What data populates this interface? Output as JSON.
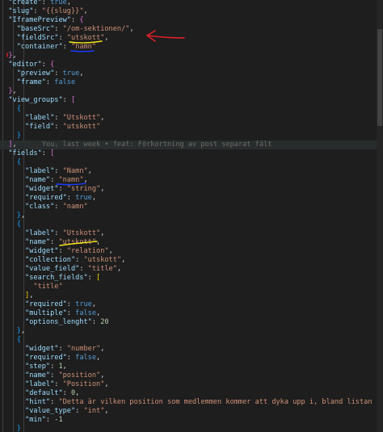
{
  "editor": {
    "blame_annotation": "You, last week • feat: Förkortning av post separat fält",
    "lines": [
      [
        [
          "p",
          "  "
        ],
        [
          "k",
          "\"create\""
        ],
        [
          "p",
          ": "
        ],
        [
          "b",
          "true"
        ],
        [
          "p",
          ","
        ]
      ],
      [
        [
          "p",
          "  "
        ],
        [
          "k",
          "\"slug\""
        ],
        [
          "p",
          ": "
        ],
        [
          "s",
          "\"{{slug}}\""
        ],
        [
          "p",
          ","
        ]
      ],
      [
        [
          "p",
          "  "
        ],
        [
          "k",
          "\"IframePreview\""
        ],
        [
          "p",
          ": "
        ],
        [
          "br2",
          "{"
        ]
      ],
      [
        [
          "p",
          "    "
        ],
        [
          "k",
          "\"baseSrc\""
        ],
        [
          "p",
          ": "
        ],
        [
          "s",
          "\"/om-sektionen/\""
        ],
        [
          "p",
          ","
        ]
      ],
      [
        [
          "p",
          "    "
        ],
        [
          "k",
          "\"fieldSrc\""
        ],
        [
          "p",
          ": "
        ],
        [
          "s",
          "\"utskott\""
        ],
        [
          "p",
          ","
        ]
      ],
      [
        [
          "p",
          "    "
        ],
        [
          "k",
          "\"container\""
        ],
        [
          "p",
          ": "
        ],
        [
          "s",
          "\"namn\""
        ]
      ],
      [
        [
          "p",
          "  "
        ],
        [
          "br2",
          "}"
        ],
        [
          "p",
          ","
        ]
      ],
      [
        [
          "p",
          "  "
        ],
        [
          "k",
          "\"editor\""
        ],
        [
          "p",
          ": "
        ],
        [
          "br2",
          "{"
        ]
      ],
      [
        [
          "p",
          "    "
        ],
        [
          "k",
          "\"preview\""
        ],
        [
          "p",
          ": "
        ],
        [
          "b",
          "true"
        ],
        [
          "p",
          ","
        ]
      ],
      [
        [
          "p",
          "    "
        ],
        [
          "k",
          "\"frame\""
        ],
        [
          "p",
          ": "
        ],
        [
          "b",
          "false"
        ]
      ],
      [
        [
          "p",
          "  "
        ],
        [
          "br2",
          "}"
        ],
        [
          "p",
          ","
        ]
      ],
      [
        [
          "p",
          "  "
        ],
        [
          "k",
          "\"view_groups\""
        ],
        [
          "p",
          ": "
        ],
        [
          "br2",
          "["
        ]
      ],
      [
        [
          "p",
          "    "
        ],
        [
          "br3",
          "{"
        ]
      ],
      [
        [
          "p",
          "      "
        ],
        [
          "k",
          "\"label\""
        ],
        [
          "p",
          ": "
        ],
        [
          "s",
          "\"Utskott\""
        ],
        [
          "p",
          ","
        ]
      ],
      [
        [
          "p",
          "      "
        ],
        [
          "k",
          "\"field\""
        ],
        [
          "p",
          ": "
        ],
        [
          "s",
          "\"utskott\""
        ]
      ],
      [
        [
          "p",
          "    "
        ],
        [
          "br3",
          "}"
        ]
      ],
      [
        [
          "p",
          "  "
        ],
        [
          "br2",
          "]"
        ],
        [
          "p",
          ","
        ],
        [
          "blame",
          "      You, last week • feat: Förkortning av post separat fält"
        ]
      ],
      [
        [
          "p",
          "  "
        ],
        [
          "k",
          "\"fields\""
        ],
        [
          "p",
          ": "
        ],
        [
          "br2",
          "["
        ]
      ],
      [
        [
          "p",
          "    "
        ],
        [
          "br3",
          "{"
        ]
      ],
      [
        [
          "p",
          "      "
        ],
        [
          "k",
          "\"label\""
        ],
        [
          "p",
          ": "
        ],
        [
          "s",
          "\"Namn\""
        ],
        [
          "p",
          ","
        ]
      ],
      [
        [
          "p",
          "      "
        ],
        [
          "k",
          "\"name\""
        ],
        [
          "p",
          ": "
        ],
        [
          "s",
          "\"namn\""
        ],
        [
          "p",
          ","
        ]
      ],
      [
        [
          "p",
          "      "
        ],
        [
          "k",
          "\"widget\""
        ],
        [
          "p",
          ": "
        ],
        [
          "s",
          "\"string\""
        ],
        [
          "p",
          ","
        ]
      ],
      [
        [
          "p",
          "      "
        ],
        [
          "k",
          "\"required\""
        ],
        [
          "p",
          ": "
        ],
        [
          "b",
          "true"
        ],
        [
          "p",
          ","
        ]
      ],
      [
        [
          "p",
          "      "
        ],
        [
          "k",
          "\"class\""
        ],
        [
          "p",
          ": "
        ],
        [
          "s",
          "\"namn\""
        ]
      ],
      [
        [
          "p",
          "    "
        ],
        [
          "br3",
          "}"
        ],
        [
          "p",
          ","
        ]
      ],
      [
        [
          "p",
          "    "
        ],
        [
          "br3",
          "{"
        ]
      ],
      [
        [
          "p",
          "      "
        ],
        [
          "k",
          "\"label\""
        ],
        [
          "p",
          ": "
        ],
        [
          "s",
          "\"Utskott\""
        ],
        [
          "p",
          ","
        ]
      ],
      [
        [
          "p",
          "      "
        ],
        [
          "k",
          "\"name\""
        ],
        [
          "p",
          ": "
        ],
        [
          "s",
          "\"utskott\""
        ],
        [
          "p",
          ","
        ]
      ],
      [
        [
          "p",
          "      "
        ],
        [
          "k",
          "\"widget\""
        ],
        [
          "p",
          ": "
        ],
        [
          "s",
          "\"relation\""
        ],
        [
          "p",
          ","
        ]
      ],
      [
        [
          "p",
          "      "
        ],
        [
          "k",
          "\"collection\""
        ],
        [
          "p",
          ": "
        ],
        [
          "s",
          "\"utskott\""
        ],
        [
          "p",
          ","
        ]
      ],
      [
        [
          "p",
          "      "
        ],
        [
          "k",
          "\"value_field\""
        ],
        [
          "p",
          ": "
        ],
        [
          "s",
          "\"title\""
        ],
        [
          "p",
          ","
        ]
      ],
      [
        [
          "p",
          "      "
        ],
        [
          "k",
          "\"search_fields\""
        ],
        [
          "p",
          ": "
        ],
        [
          "br1",
          "["
        ]
      ],
      [
        [
          "p",
          "        "
        ],
        [
          "s",
          "\"title\""
        ]
      ],
      [
        [
          "p",
          "      "
        ],
        [
          "br1",
          "]"
        ],
        [
          "p",
          ","
        ]
      ],
      [
        [
          "p",
          "      "
        ],
        [
          "k",
          "\"required\""
        ],
        [
          "p",
          ": "
        ],
        [
          "b",
          "true"
        ],
        [
          "p",
          ","
        ]
      ],
      [
        [
          "p",
          "      "
        ],
        [
          "k",
          "\"multiple\""
        ],
        [
          "p",
          ": "
        ],
        [
          "b",
          "false"
        ],
        [
          "p",
          ","
        ]
      ],
      [
        [
          "p",
          "      "
        ],
        [
          "k",
          "\"options_lenght\""
        ],
        [
          "p",
          ": "
        ],
        [
          "n",
          "20"
        ]
      ],
      [
        [
          "p",
          "    "
        ],
        [
          "br3",
          "}"
        ],
        [
          "p",
          ","
        ]
      ],
      [
        [
          "p",
          "    "
        ],
        [
          "br3",
          "{"
        ]
      ],
      [
        [
          "p",
          "      "
        ],
        [
          "k",
          "\"widget\""
        ],
        [
          "p",
          ": "
        ],
        [
          "s",
          "\"number\""
        ],
        [
          "p",
          ","
        ]
      ],
      [
        [
          "p",
          "      "
        ],
        [
          "k",
          "\"required\""
        ],
        [
          "p",
          ": "
        ],
        [
          "b",
          "false"
        ],
        [
          "p",
          ","
        ]
      ],
      [
        [
          "p",
          "      "
        ],
        [
          "k",
          "\"step\""
        ],
        [
          "p",
          ": "
        ],
        [
          "n",
          "1"
        ],
        [
          "p",
          ","
        ]
      ],
      [
        [
          "p",
          "      "
        ],
        [
          "k",
          "\"name\""
        ],
        [
          "p",
          ": "
        ],
        [
          "s",
          "\"position\""
        ],
        [
          "p",
          ","
        ]
      ],
      [
        [
          "p",
          "      "
        ],
        [
          "k",
          "\"label\""
        ],
        [
          "p",
          ": "
        ],
        [
          "s",
          "\"Position\""
        ],
        [
          "p",
          ","
        ]
      ],
      [
        [
          "p",
          "      "
        ],
        [
          "k",
          "\"default\""
        ],
        [
          "p",
          ": "
        ],
        [
          "n",
          "0"
        ],
        [
          "p",
          ","
        ]
      ],
      [
        [
          "p",
          "      "
        ],
        [
          "k",
          "\"hint\""
        ],
        [
          "p",
          ": "
        ],
        [
          "s",
          "\"Detta är vilken position som medlemmen kommer att dyka upp i, bland listan av medle"
        ]
      ],
      [
        [
          "p",
          "      "
        ],
        [
          "k",
          "\"value_type\""
        ],
        [
          "p",
          ": "
        ],
        [
          "s",
          "\"int\""
        ],
        [
          "p",
          ","
        ]
      ],
      [
        [
          "p",
          "      "
        ],
        [
          "k",
          "\"min\""
        ],
        [
          "p",
          ": "
        ],
        [
          "n",
          "-1"
        ]
      ],
      [
        [
          "p",
          "    "
        ],
        [
          "br3",
          "}"
        ]
      ]
    ]
  },
  "colors": {
    "background": "#1e1e1e",
    "key": "#9cdcfe",
    "string": "#ce9178",
    "number": "#b5cea8",
    "boolean": "#569cd6",
    "annotation_red": "#e0202a",
    "annotation_yellow": "#f5e51a",
    "annotation_blue": "#1a3cff"
  },
  "annotations": [
    "red-arrow",
    "yellow-underline",
    "blue-underline"
  ]
}
